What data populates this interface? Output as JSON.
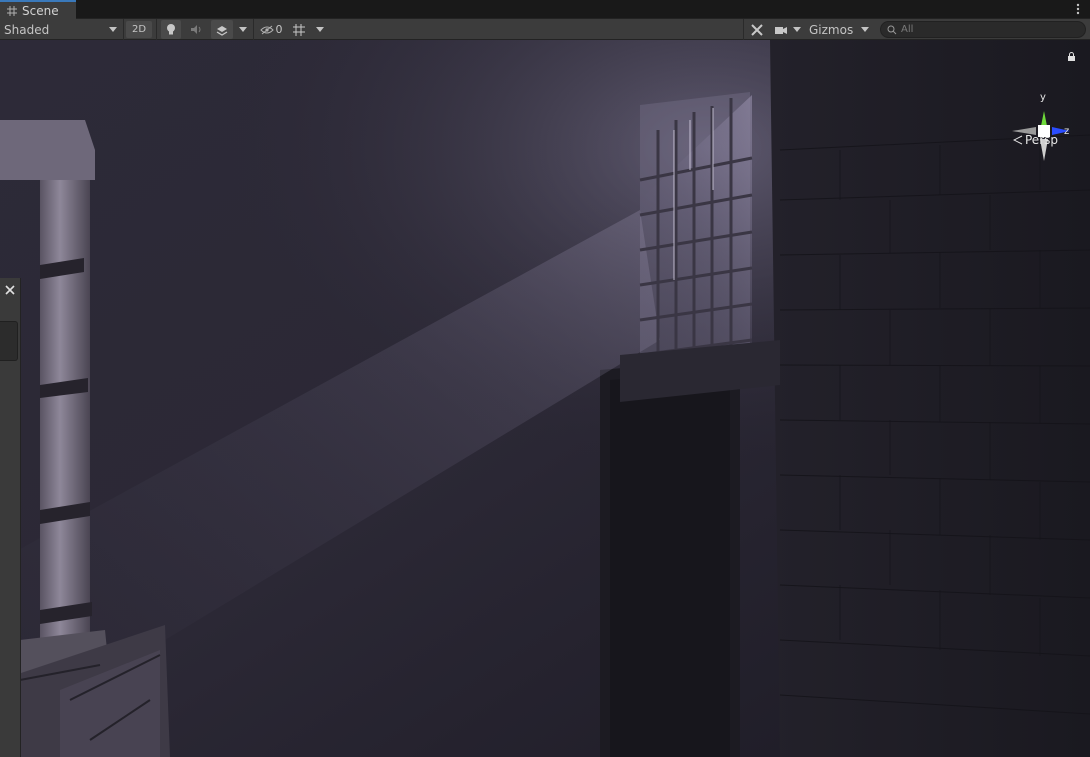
{
  "tab": {
    "title": "Scene",
    "icon": "grid-icon"
  },
  "toolbar": {
    "draw_mode": "Shaded",
    "toggle_2d": "2D",
    "hidden_count": "0",
    "gizmos_label": "Gizmos",
    "search_placeholder": "All"
  },
  "scene_gizmo": {
    "projection_label": "Persp",
    "axis_y": "y",
    "axis_z": "z",
    "colors": {
      "y": "#6ed93a",
      "z": "#2b4dff",
      "x": "#9a9a9a"
    }
  },
  "colors": {
    "accent": "#3a79bb",
    "toolbar_bg": "#3c3c3c",
    "panel_bg": "#191919"
  }
}
